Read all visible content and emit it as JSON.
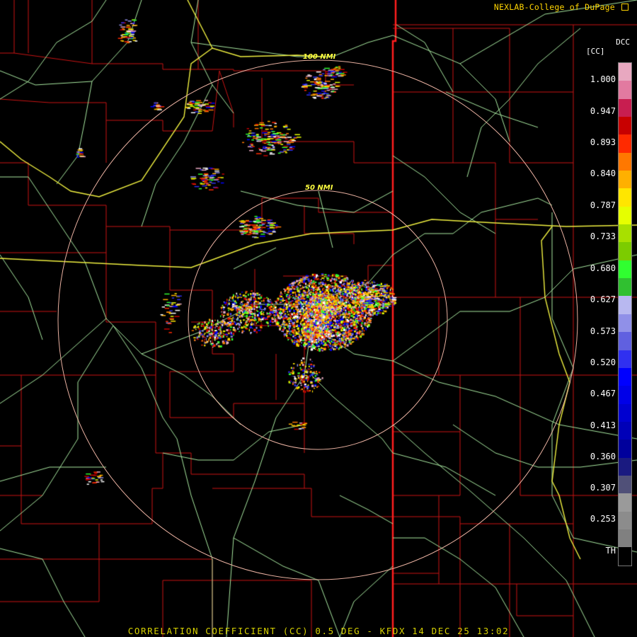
{
  "credit": "NEXLAB-College of DuPage",
  "caption": "CORRELATION COEFFICIENT (CC) 0.5 DEG - KFDX 14 DEC 25 13:02",
  "legend": {
    "title": "DCC",
    "short": "[CC]",
    "ticks": [
      "1.000",
      "0.947",
      "0.893",
      "0.840",
      "0.787",
      "0.733",
      "0.680",
      "0.627",
      "0.573",
      "0.520",
      "0.467",
      "0.413",
      "0.360",
      "0.307",
      "0.253",
      "TH"
    ],
    "colors": [
      "#e8a8c0",
      "#e27aa0",
      "#c81e50",
      "#c80000",
      "#ff2a00",
      "#ff7800",
      "#ffb000",
      "#ffe600",
      "#e6ff00",
      "#a8e000",
      "#7ccc00",
      "#30ff30",
      "#30c030",
      "#b8b8f0",
      "#9090e8",
      "#6060e0",
      "#3030f0",
      "#0000ff",
      "#0000e8",
      "#0000d0",
      "#0000b8",
      "#00009c",
      "#1a1a80",
      "#505078",
      "#9a9a9a",
      "#8c8c8c",
      "#808080",
      "#000000"
    ]
  },
  "range_rings": [
    "100 NMI",
    "50 NMI"
  ],
  "colors": {
    "county_lines": "#c81414",
    "state_line": "#ff1e1e",
    "roads": "#a8e8a0",
    "highways": "#f0f040",
    "rings": "#e8b0a0"
  }
}
